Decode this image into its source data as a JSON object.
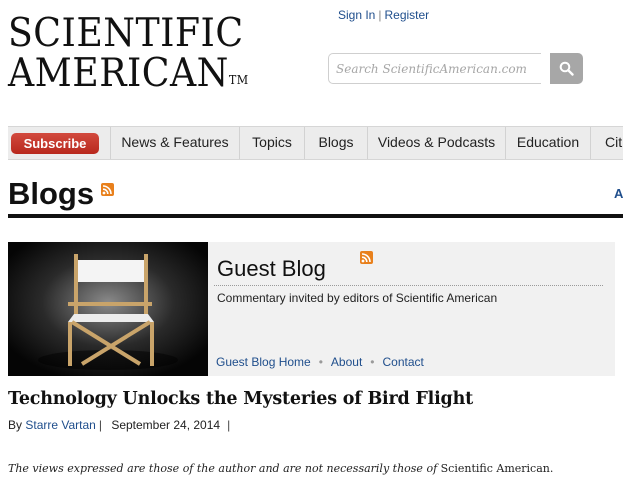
{
  "logo": {
    "line1": "SCIENTIFIC",
    "line2": "AMERICAN",
    "tm": "TM"
  },
  "top_links": {
    "sign_in": "Sign In",
    "separator": "|",
    "register": "Register"
  },
  "search": {
    "placeholder": "Search ScientificAmerican.com",
    "icon": "search-icon"
  },
  "nav": {
    "subscribe": "Subscribe",
    "items": [
      "News & Features",
      "Topics",
      "Blogs",
      "Videos & Podcasts",
      "Education",
      "Cit"
    ]
  },
  "blogs_header": {
    "title": "Blogs",
    "right_label": "A"
  },
  "guest_blog": {
    "title": "Guest Blog",
    "description": "Commentary invited by editors of Scientific American",
    "links": [
      "Guest Blog Home",
      "About",
      "Contact"
    ]
  },
  "article": {
    "title": "Technology Unlocks the Mysteries of Bird Flight",
    "by_prefix": "By",
    "author": "Starre Vartan",
    "date": "September 24, 2014",
    "disclaimer_main": "The views expressed are those of the author and are not necessarily those of",
    "disclaimer_pub": "Scientific American."
  },
  "colors": {
    "link": "#1f4e8c",
    "subscribe": "#c2332a",
    "rss": "#e8801c"
  }
}
